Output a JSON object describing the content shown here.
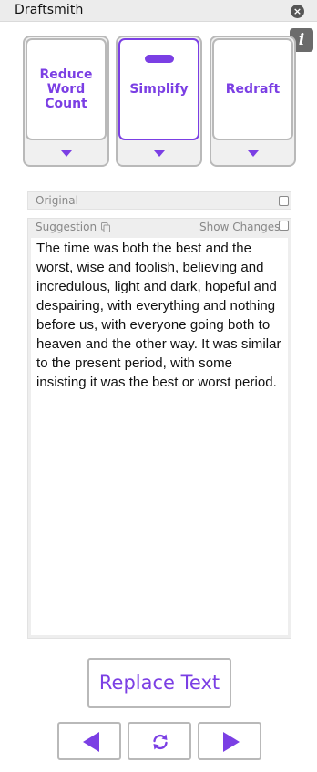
{
  "app": {
    "title": "Draftsmith",
    "close_icon": "close-icon",
    "info_icon": "info-icon",
    "info_glyph": "i",
    "close_glyph": "×"
  },
  "modes": [
    {
      "label": "Reduce\nWord\nCount",
      "selected": false
    },
    {
      "label": "Simplify",
      "selected": true
    },
    {
      "label": "Redraft",
      "selected": false
    }
  ],
  "original": {
    "label": "Original",
    "checked": false
  },
  "suggestion": {
    "label": "Suggestion",
    "show_changes_label": "Show Changes",
    "show_changes_checked": false,
    "text": "The time was both the best and the worst, wise and foolish, believing and incredulous, light and dark, hopeful and despairing, with everything and nothing before us, with everyone going both to heaven and the other way. It was similar to the present period, with some insisting it was the best or worst period."
  },
  "actions": {
    "replace_label": "Replace Text",
    "prev_icon": "triangle-left-icon",
    "refresh_icon": "refresh-icon",
    "next_icon": "triangle-right-icon"
  },
  "colors": {
    "accent": "#7b3fe4",
    "border": "#b9b9b9",
    "titlebar": "#ececec"
  }
}
